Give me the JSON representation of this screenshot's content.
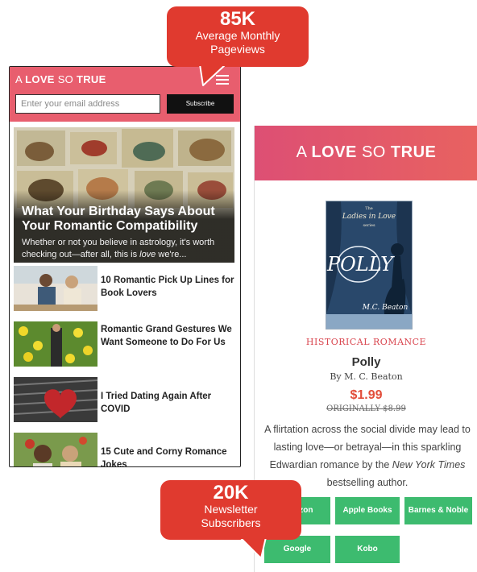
{
  "phone": {
    "logo_regular": "A ",
    "logo_bold": "LOVE",
    "logo_regular2": " SO ",
    "logo_bold2": "TRUE",
    "email_placeholder": "Enter your email address",
    "subscribe_label": "Subscribe",
    "featured": {
      "title": "What Your Birthday Says About Your Romantic Compatibility",
      "desc_before": "Whether or not you believe in astrology, it's worth checking out—after all, this is ",
      "desc_em": "love",
      "desc_after": " we're..."
    },
    "articles": [
      {
        "title": "10 Romantic Pick Up Lines for Book Lovers"
      },
      {
        "title": "Romantic Grand Gestures We Want Someone to Do For Us"
      },
      {
        "title": "I Tried Dating Again After COVID"
      },
      {
        "title": "15 Cute and Corny Romance Jokes"
      }
    ]
  },
  "callouts": {
    "top": {
      "number": "85K",
      "line1": "Average Monthly",
      "line2": "Pageviews"
    },
    "bottom": {
      "number": "20K",
      "line1": "Newsletter",
      "line2": "Subscribers"
    }
  },
  "site": {
    "logo_regular": "A ",
    "logo_bold": "LOVE",
    "logo_regular2": " SO ",
    "logo_bold2": "TRUE",
    "cover": {
      "series_top": "The",
      "series_mid": "Ladies in Love",
      "series_bot": "series",
      "title": "Polly",
      "author": "M.C. Beaton"
    },
    "genre": "HISTORICAL ROMANCE",
    "book_title": "Polly",
    "author": "By M. C. Beaton",
    "price": "$1.99",
    "original_price": "ORIGINALLY $8.99",
    "desc_before": "A flirtation across the social divide may lead to lasting love—or betrayal—in this sparkling Edwardian romance by the ",
    "desc_em": "New York Times",
    "desc_after": " bestselling author.",
    "buttons": {
      "amazon": "Amazon",
      "apple": "Apple Books",
      "bn": "Barnes & Noble",
      "google": "Google",
      "kobo": "Kobo"
    }
  },
  "colors": {
    "brand_pink": "#e85e6e",
    "callout_red": "#e03a2f",
    "button_green": "#3dbb6f",
    "price_red": "#e24d3a"
  }
}
